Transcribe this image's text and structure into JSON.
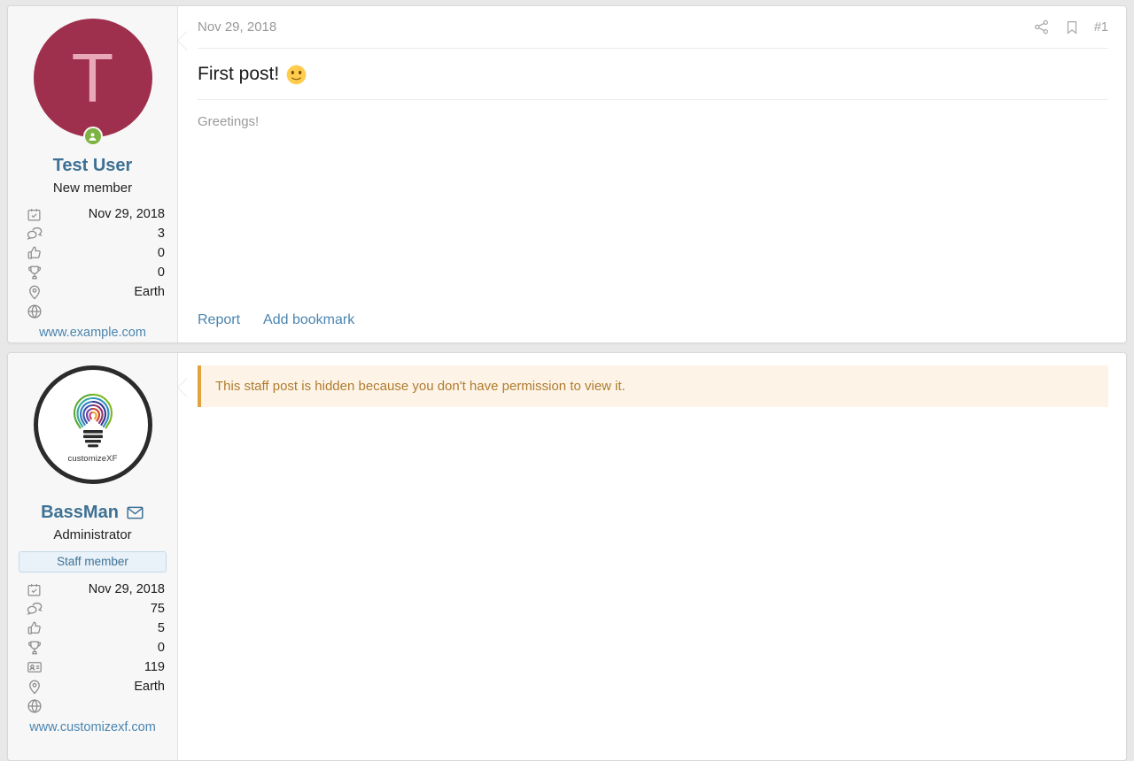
{
  "posts": [
    {
      "user": {
        "avatar_type": "letter",
        "avatar_letter": "T",
        "avatar_bg": "#9e2f4d",
        "avatar_fg": "#e9a8b8",
        "online": true,
        "name": "Test User",
        "title": "New member",
        "staff_banner": null,
        "has_message_icon": false,
        "stats": [
          {
            "icon": "calendar-check-icon",
            "label": "joined-date",
            "value": "Nov 29, 2018"
          },
          {
            "icon": "messages-icon",
            "label": "messages-count",
            "value": "3"
          },
          {
            "icon": "thumbs-up-icon",
            "label": "reaction-score",
            "value": "0"
          },
          {
            "icon": "trophy-icon",
            "label": "points",
            "value": "0"
          },
          {
            "icon": "map-pin-icon",
            "label": "location",
            "value": "Earth"
          }
        ],
        "website_icon": "globe-icon",
        "website": "www.example.com"
      },
      "header": {
        "date": "Nov 29, 2018",
        "share_icon": "share-icon",
        "bookmark_icon": "bookmark-icon",
        "post_number": "#1"
      },
      "title": "First post!",
      "title_emoji": "slight-smile-emoji",
      "body": "Greetings!",
      "notice": null,
      "footer_links": [
        "Report",
        "Add bookmark"
      ]
    },
    {
      "user": {
        "avatar_type": "logo",
        "avatar_logo_text": "customizeXF",
        "online": false,
        "name": "BassMan",
        "title": "Administrator",
        "staff_banner": "Staff member",
        "has_message_icon": true,
        "message_icon": "envelope-icon",
        "stats": [
          {
            "icon": "calendar-check-icon",
            "label": "joined-date",
            "value": "Nov 29, 2018"
          },
          {
            "icon": "messages-icon",
            "label": "messages-count",
            "value": "75"
          },
          {
            "icon": "thumbs-up-icon",
            "label": "reaction-score",
            "value": "5"
          },
          {
            "icon": "trophy-icon",
            "label": "points",
            "value": "0"
          },
          {
            "icon": "id-card-icon",
            "label": "member-id",
            "value": "119"
          },
          {
            "icon": "map-pin-icon",
            "label": "location",
            "value": "Earth"
          }
        ],
        "website_icon": "globe-icon",
        "website": "www.customizexf.com"
      },
      "header": null,
      "title": null,
      "body": null,
      "notice": "This staff post is hidden because you don't have permission to view it.",
      "footer_links": []
    }
  ],
  "colors": {
    "link": "#4a85b0",
    "username": "#3e7194",
    "notice_border": "#e0a33f",
    "notice_bg": "#fdf4e7",
    "notice_text": "#b07b2e",
    "online_badge": "#7cb342",
    "avatar_bg": "#9e2f4d"
  }
}
